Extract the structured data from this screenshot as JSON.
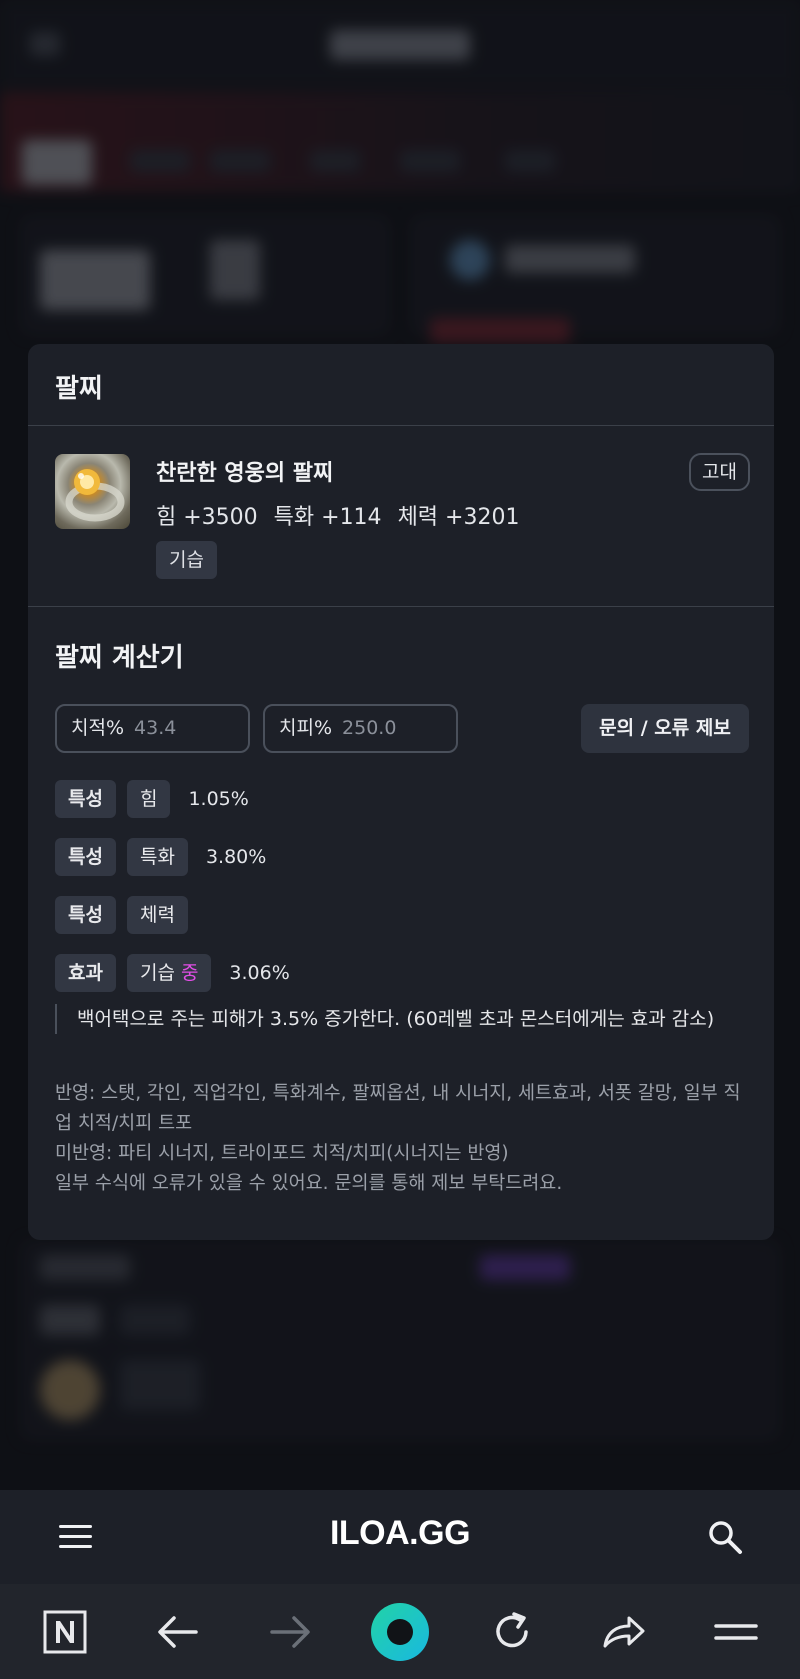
{
  "modal": {
    "title": "팔찌",
    "item": {
      "name": "찬란한 영웅의 팔찌",
      "grade": "고대",
      "stats": [
        "힘 +3500",
        "특화 +114",
        "체력 +3201"
      ],
      "tag": "기습"
    },
    "calculator": {
      "title": "팔찌 계산기",
      "crit_rate": {
        "label": "치적%",
        "placeholder": "43.4"
      },
      "crit_damage": {
        "label": "치피%",
        "placeholder": "250.0"
      },
      "report_button": "문의 / 오류 제보",
      "rows": [
        {
          "type": "특성",
          "name": "힘",
          "level": "",
          "value": "1.05%"
        },
        {
          "type": "특성",
          "name": "특화",
          "level": "",
          "value": "3.80%"
        },
        {
          "type": "특성",
          "name": "체력",
          "level": "",
          "value": ""
        },
        {
          "type": "효과",
          "name": "기습",
          "level": "중",
          "value": "3.06%"
        }
      ],
      "effect_description": "백어택으로 주는 피해가 3.5% 증가한다. (60레벨 초과 몬스터에게는 효과 감소)",
      "notes": [
        "반영: 스탯, 각인, 직업각인, 특화계수, 팔찌옵션, 내 시너지, 세트효과, 서폿 갈망, 일부 직업 치적/치피 트포",
        "미반영: 파티 시너지, 트라이포드 치적/치피(시너지는 반영)",
        "일부 수식에 오류가 있을 수 있어요. 문의를 통해 제보 부탁드려요."
      ]
    }
  },
  "site_bar": {
    "logo": "ILOA.GG",
    "menu_icon": "hamburger-icon",
    "search_icon": "search-icon"
  },
  "browser_bar": {
    "buttons": [
      "naver-n-icon",
      "back-arrow-icon",
      "forward-arrow-icon",
      "home-circle-icon",
      "reload-icon",
      "share-icon",
      "menu-icon"
    ]
  },
  "colors": {
    "background": "#121419",
    "modal": "#1d2028",
    "chip": "#323743",
    "level_mid": "#e14ee6",
    "home_gradient": [
      "#22d3a6",
      "#19b8e0"
    ]
  }
}
